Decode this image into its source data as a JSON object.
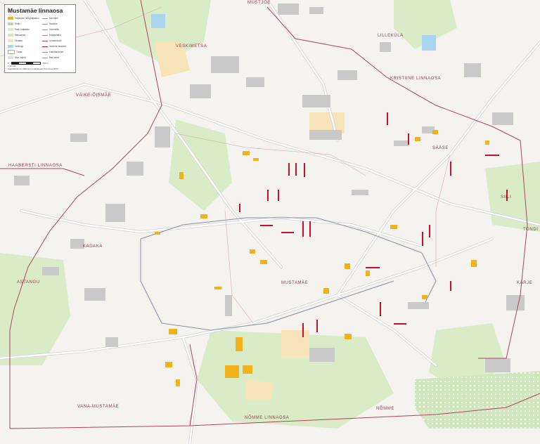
{
  "map": {
    "title": "Mustamäe linnaosa",
    "colors": {
      "background": "#f4f3ef",
      "green": "#d9ecc7",
      "forest": "#cfe6bf",
      "building": "#c9c9c9",
      "road": "#ffffff",
      "road_casing": "#d2d2d2",
      "main_road": "#8a8fa3",
      "boundary": "#b8405e",
      "highlight_red": "#c8102e",
      "highlight_orange": "#f2b21b",
      "sand": "#f6e3b8",
      "water": "#a9d4ee"
    },
    "district_labels": {
      "kesklinn_n": "MUSTJÕE",
      "veskimetsa": "VESKIMETSA",
      "lilleküla": "LILLEKÜLA",
      "kristiine": "KRISTIINE LINNAOSA",
      "vaike_oismae": "VÄIKE-ÕISMÄE",
      "haabersti": "HAABERSTI LINNAOSA",
      "saase": "SÄÄSE",
      "siili": "SIILI",
      "kadaka": "KADAKA",
      "astangu": "ASTANGU",
      "mustamae": "MUSTAMÄE",
      "tondi": "TONDI",
      "karje": "KÄRJE",
      "vana_mustamae": "VANA-MUSTAMÄE",
      "nomme_village": "NÕMME",
      "nomme": "NÕMME LINNAOSA"
    },
    "legend": {
      "items_left": [
        {
          "label": "Haljasala / kõrghaljastus",
          "color": "#f2b21b"
        },
        {
          "label": "Ehitis",
          "color": "#c9c9c9"
        },
        {
          "label": "Park, haljastus",
          "color": "#d9ecc7"
        },
        {
          "label": "Metsamaa",
          "color": "#cfe6bf"
        },
        {
          "label": "Liivaala",
          "color": "#f6e3b8"
        },
        {
          "label": "Veekogu",
          "color": "#a9d4ee"
        },
        {
          "label": "Tänav",
          "color": "#ffffff"
        },
        {
          "label": "Muu objekt",
          "color": "#e0e0e0"
        }
      ],
      "items_right": [
        {
          "label": "Asumipiir"
        },
        {
          "label": "Raudtee"
        },
        {
          "label": "Trammiliin"
        },
        {
          "label": "Bussipeatus"
        },
        {
          "label": "Linnaosa piir"
        },
        {
          "label": "Hoonete fassaad"
        },
        {
          "label": "Kaardiandmed"
        },
        {
          "label": "Maa-amet"
        }
      ],
      "scale_text": "1:12 000",
      "scale_ticks": [
        "0",
        "250",
        "500 m"
      ],
      "source": "Kaardiandmed: Tallinna Linnaplaneerimise Amet 2015"
    }
  }
}
